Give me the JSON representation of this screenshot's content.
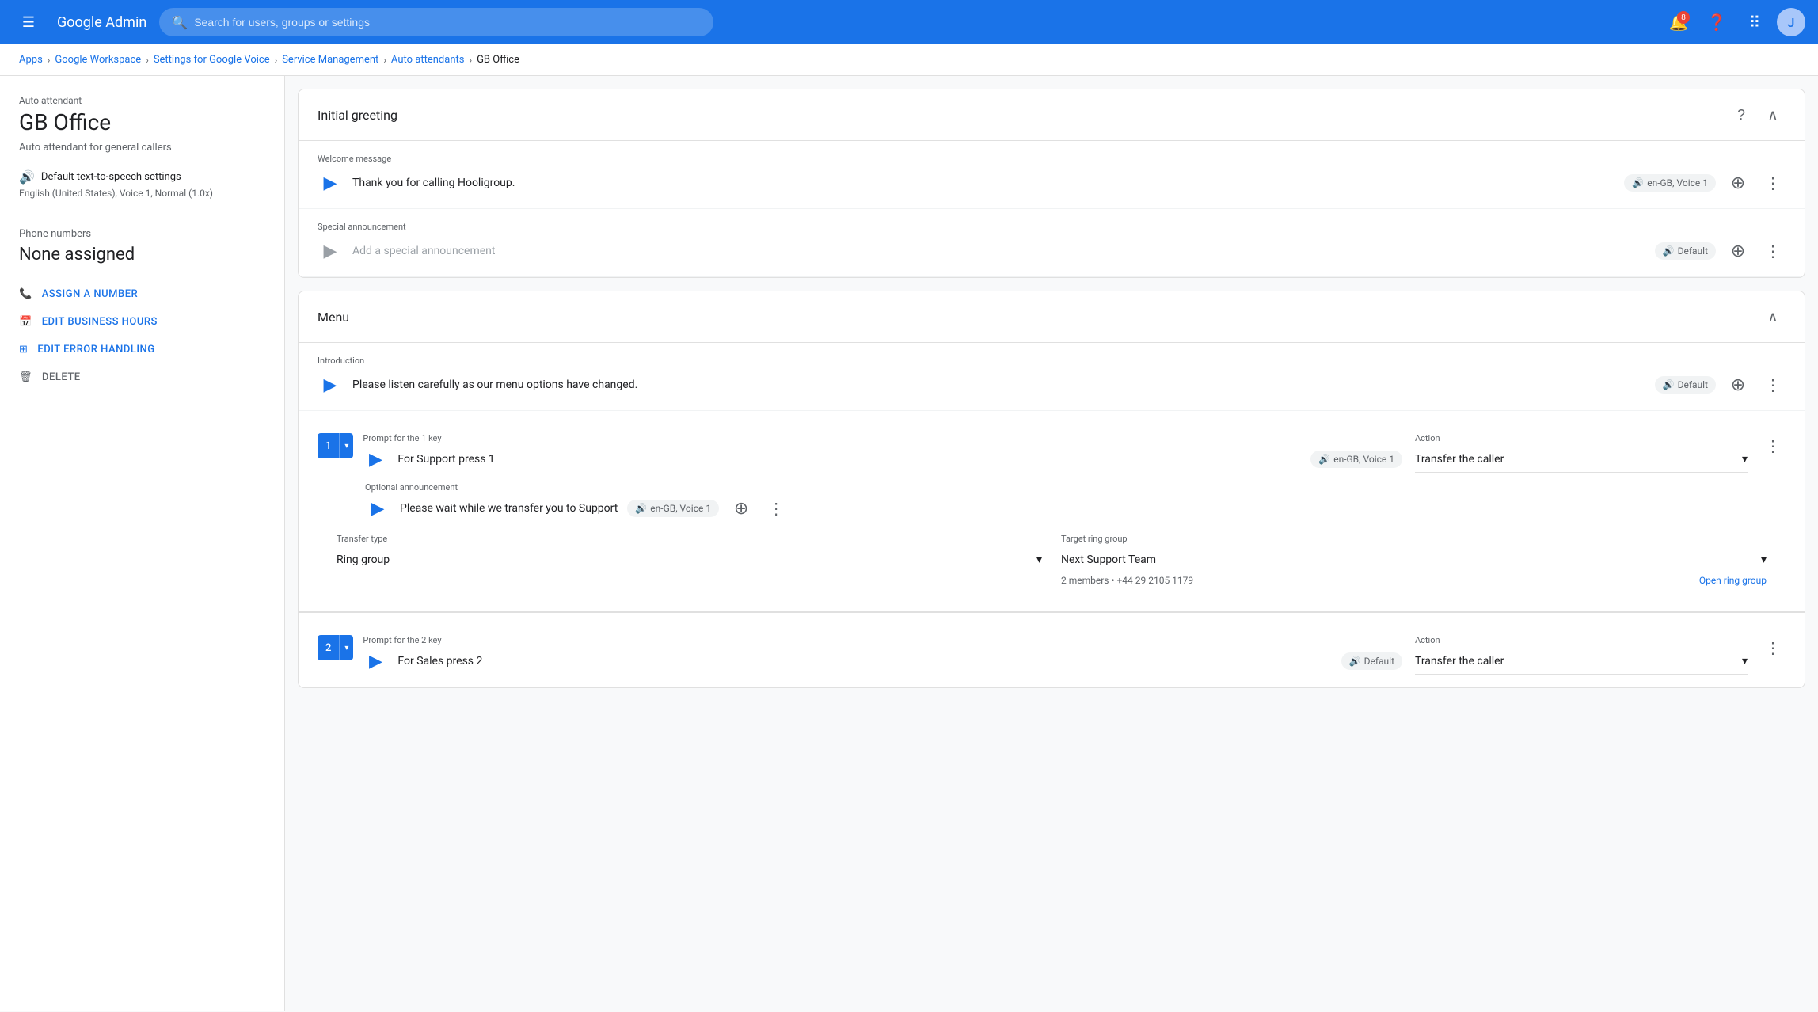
{
  "topNav": {
    "hamburger_icon": "☰",
    "logo_text": "Google Admin",
    "search_placeholder": "Search for users, groups or settings",
    "help_badge": "8",
    "help_icon": "?",
    "apps_icon": "⠿",
    "avatar_letter": "J"
  },
  "breadcrumb": {
    "items": [
      {
        "label": "Apps",
        "link": true
      },
      {
        "label": "Google Workspace",
        "link": true
      },
      {
        "label": "Settings for Google Voice",
        "link": true
      },
      {
        "label": "Service Management",
        "link": true
      },
      {
        "label": "Auto attendants",
        "link": true
      },
      {
        "label": "GB Office",
        "link": false
      }
    ]
  },
  "sidebar": {
    "type_label": "Auto attendant",
    "name": "GB Office",
    "description": "Auto attendant for general callers",
    "tts_icon": "tts",
    "tts_label": "Default text-to-speech settings",
    "tts_value": "English (United States), Voice 1, Normal (1.0x)",
    "phone_section_label": "Phone numbers",
    "phone_value": "None assigned",
    "actions": [
      {
        "icon": "📞",
        "label": "ASSIGN A NUMBER",
        "type": "normal"
      },
      {
        "icon": "📅",
        "label": "EDIT BUSINESS HOURS",
        "type": "normal"
      },
      {
        "icon": "⚙",
        "label": "EDIT ERROR HANDLING",
        "type": "normal"
      },
      {
        "icon": "🗑",
        "label": "DELETE",
        "type": "delete"
      }
    ]
  },
  "initialGreeting": {
    "section_title": "Initial greeting",
    "welcomeMessage": {
      "label": "Welcome message",
      "text_before": "Thank you for calling ",
      "highlighted": "Hooligroup",
      "text_after": ".",
      "voice_badge": "en-GB, Voice 1"
    },
    "specialAnnouncement": {
      "label": "Special announcement",
      "placeholder": "Add a special announcement",
      "voice_badge": "Default"
    }
  },
  "menu": {
    "section_title": "Menu",
    "introduction": {
      "label": "Introduction",
      "text": "Please listen carefully as our menu options have changed.",
      "voice_badge": "Default"
    },
    "key1": {
      "key_number": "1",
      "prompt_label": "Prompt for the 1 key",
      "prompt_text": "For Support press 1",
      "voice_badge": "en-GB, Voice 1",
      "action_label": "Action",
      "action_value": "Transfer the caller",
      "optional_announcement_label": "Optional announcement",
      "optional_text": "Please wait while we transfer you to Support",
      "optional_voice_badge": "en-GB, Voice 1",
      "transfer_type_label": "Transfer type",
      "transfer_type_value": "Ring group",
      "target_label": "Target ring group",
      "target_value": "Next Support Team",
      "target_meta": "2 members • +44 29 2105 1179",
      "open_link": "Open ring group"
    },
    "key2": {
      "key_number": "2",
      "prompt_label": "Prompt for the 2 key",
      "prompt_text": "For Sales press 2",
      "voice_badge": "Default",
      "action_label": "Action",
      "action_value": "Transfer the caller"
    }
  }
}
